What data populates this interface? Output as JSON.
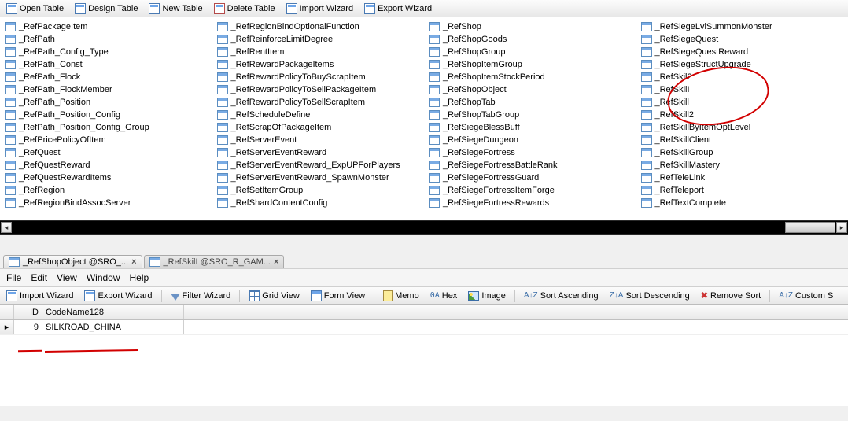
{
  "topToolbar": {
    "openTable": "Open Table",
    "designTable": "Design Table",
    "newTable": "New Table",
    "deleteTable": "Delete Table",
    "importWizard": "Import Wizard",
    "exportWizard": "Export Wizard"
  },
  "tables": {
    "col1": [
      "_RefPackageItem",
      "_RefPath",
      "_RefPath_Config_Type",
      "_RefPath_Const",
      "_RefPath_Flock",
      "_RefPath_FlockMember",
      "_RefPath_Position",
      "_RefPath_Position_Config",
      "_RefPath_Position_Config_Group",
      "_RefPricePolicyOfItem",
      "_RefQuest",
      "_RefQuestReward",
      "_RefQuestRewardItems",
      "_RefRegion",
      "_RefRegionBindAssocServer"
    ],
    "col2": [
      "_RefRegionBindOptionalFunction",
      "_RefReinforceLimitDegree",
      "_RefRentItem",
      "_RefRewardPackageItems",
      "_RefRewardPolicyToBuyScrapItem",
      "_RefRewardPolicyToSellPackageItem",
      "_RefRewardPolicyToSellScrapItem",
      "_RefScheduleDefine",
      "_RefScrapOfPackageItem",
      "_RefServerEvent",
      "_RefServerEventReward",
      "_RefServerEventReward_ExpUPForPlayers",
      "_RefServerEventReward_SpawnMonster",
      "_RefSetItemGroup",
      "_RefShardContentConfig"
    ],
    "col3": [
      "_RefShop",
      "_RefShopGoods",
      "_RefShopGroup",
      "_RefShopItemGroup",
      "_RefShopItemStockPeriod",
      "_RefShopObject",
      "_RefShopTab",
      "_RefShopTabGroup",
      "_RefSiegeBlessBuff",
      "_RefSiegeDungeon",
      "_RefSiegeFortress",
      "_RefSiegeFortressBattleRank",
      "_RefSiegeFortressGuard",
      "_RefSiegeFortressItemForge",
      "_RefSiegeFortressRewards"
    ],
    "col4": [
      "_RefSiegeLvlSummonMonster",
      "_RefSiegeQuest",
      "_RefSiegeQuestReward",
      "_RefSiegeStructUpgrade",
      "_RefSkil2",
      "_RefSkilI",
      "_RefSkill",
      "_RefSkill2",
      "_RefSkillByItemOptLevel",
      "_RefSkillClient",
      "_RefSkillGroup",
      "_RefSkillMastery",
      "_RefTeleLink",
      "_RefTeleport",
      "_RefTextComplete"
    ]
  },
  "tabs": [
    {
      "label": "_RefShopObject @SRO_...",
      "active": true
    },
    {
      "label": "_RefSkilI @SRO_R_GAM...",
      "active": false
    }
  ],
  "menubar": [
    "File",
    "Edit",
    "View",
    "Window",
    "Help"
  ],
  "lowerToolbar": {
    "importWizard": "Import Wizard",
    "exportWizard": "Export Wizard",
    "filterWizard": "Filter Wizard",
    "gridView": "Grid View",
    "formView": "Form View",
    "memo": "Memo",
    "hex": "Hex",
    "image": "Image",
    "sortAsc": "Sort Ascending",
    "sortDesc": "Sort Descending",
    "removeSort": "Remove Sort",
    "customSort": "Custom S"
  },
  "grid": {
    "headers": {
      "id": "ID",
      "code": "CodeName128"
    },
    "rows": [
      {
        "id": "9",
        "code": "SILKROAD_CHINA"
      }
    ]
  }
}
